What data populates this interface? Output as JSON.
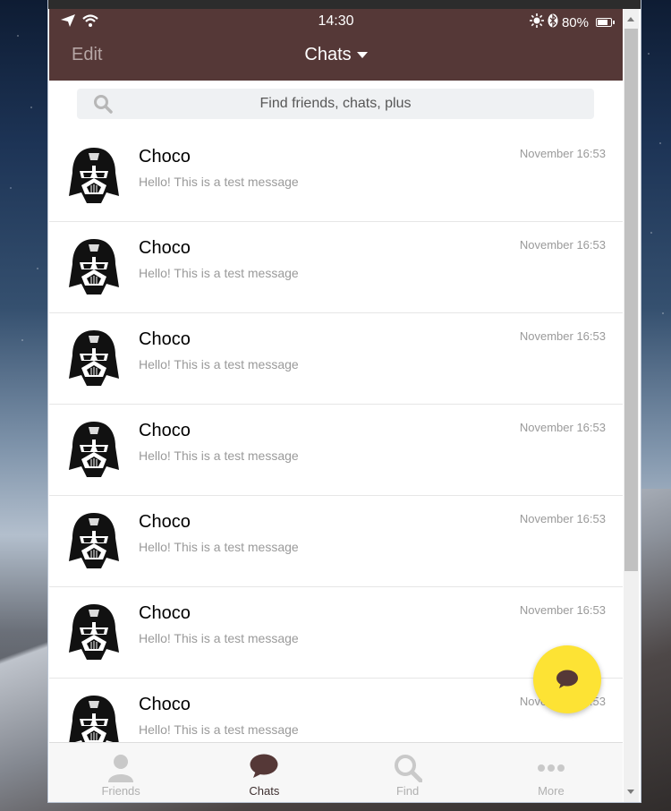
{
  "status_bar": {
    "time": "14:30",
    "battery": "80%",
    "battery_level": 0.8,
    "icons": [
      "location-arrow-icon",
      "wifi-icon",
      "brightness-icon",
      "bluetooth-icon",
      "battery-icon"
    ]
  },
  "nav": {
    "edit_label": "Edit",
    "title": "Chats"
  },
  "search": {
    "placeholder": "Find friends, chats, plus"
  },
  "chats": [
    {
      "name": "Choco",
      "message": "Hello! This is a test message",
      "time": "November 16:53"
    },
    {
      "name": "Choco",
      "message": "Hello! This is a test message",
      "time": "November 16:53"
    },
    {
      "name": "Choco",
      "message": "Hello! This is a test message",
      "time": "November 16:53"
    },
    {
      "name": "Choco",
      "message": "Hello! This is a test message",
      "time": "November 16:53"
    },
    {
      "name": "Choco",
      "message": "Hello! This is a test message",
      "time": "November 16:53"
    },
    {
      "name": "Choco",
      "message": "Hello! This is a test message",
      "time": "November 16:53"
    },
    {
      "name": "Choco",
      "message": "Hello! This is a test message",
      "time": "November 16:53"
    }
  ],
  "tabs": [
    {
      "label": "Friends",
      "icon": "person-icon",
      "active": false
    },
    {
      "label": "Chats",
      "icon": "chat-bubble-icon",
      "active": true
    },
    {
      "label": "Find",
      "icon": "search-icon",
      "active": false
    },
    {
      "label": "More",
      "icon": "more-dots-icon",
      "active": false
    }
  ],
  "colors": {
    "header_bg": "#553837",
    "fab_bg": "#fde334",
    "active_tab": "#553837"
  }
}
